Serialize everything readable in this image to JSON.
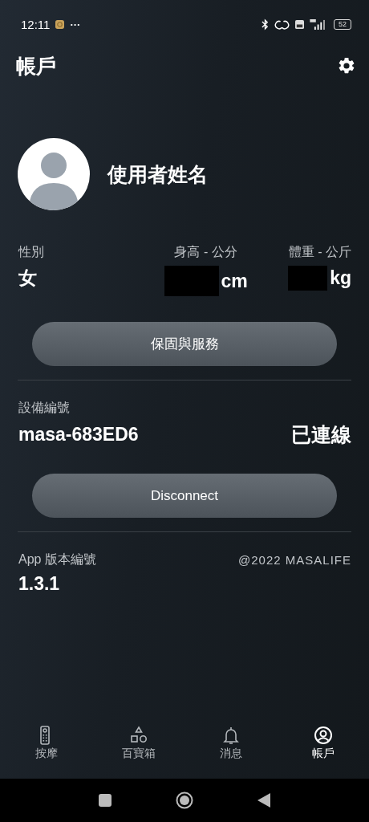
{
  "status_bar": {
    "time": "12:11",
    "more": "···",
    "battery": "52"
  },
  "header": {
    "title": "帳戶"
  },
  "profile": {
    "name": "使用者姓名"
  },
  "stats": [
    {
      "label": "性別",
      "value": "女"
    },
    {
      "label": "身高 - 公分",
      "redacted": true,
      "unit": "cm"
    },
    {
      "label": "體重 - 公斤",
      "redacted": true,
      "unit": "kg"
    }
  ],
  "warranty_button": "保固與服務",
  "device": {
    "label": "設備編號",
    "id": "masa-683ED6",
    "status": "已連線"
  },
  "disconnect_button": "Disconnect",
  "app": {
    "label": "App 版本編號",
    "copyright": "@2022 MASALIFE",
    "version": "1.3.1"
  },
  "bottom_nav": [
    {
      "label": "按摩",
      "kind": "remote",
      "selected": false
    },
    {
      "label": "百寶箱",
      "kind": "shapes",
      "selected": false
    },
    {
      "label": "消息",
      "kind": "bell",
      "selected": false
    },
    {
      "label": "帳戶",
      "kind": "account",
      "selected": true
    }
  ]
}
